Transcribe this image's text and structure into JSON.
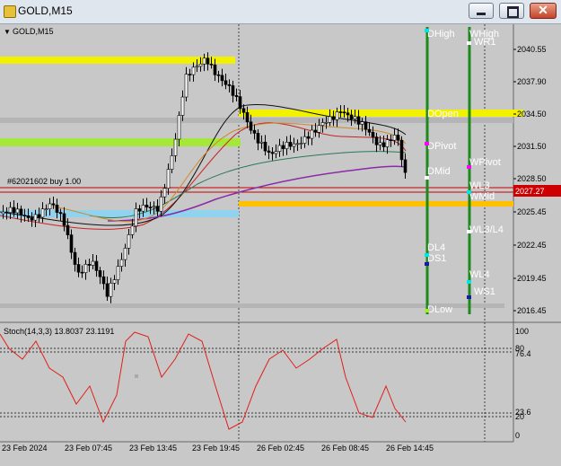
{
  "window": {
    "title": "GOLD,M15",
    "minimize_icon": "minimize-icon",
    "maximize_icon": "maximize-icon",
    "close_icon": "close-icon"
  },
  "chart": {
    "symbol_label": "GOLD,M15",
    "position_label": "#62021602 buy 1.00",
    "current_price": "2027.27",
    "price_ticks": [
      "2040.55",
      "2037.90",
      "2034.50",
      "2031.50",
      "2028.50",
      "2025.45",
      "2022.45",
      "2019.45",
      "2016.45"
    ],
    "time_ticks": [
      "23 Feb 2024",
      "23 Feb 07:45",
      "23 Feb 13:45",
      "23 Feb 19:45",
      "26 Feb 02:45",
      "26 Feb 08:45",
      "26 Feb 14:45"
    ],
    "levels": {
      "dhigh": "DHigh",
      "whigh": "WHigh",
      "wr1": "WR1",
      "dopen": "DOpen",
      "dpivot": "DPivot",
      "dmid": "DMid",
      "wpivot": "WPivot",
      "wl3": "WL3",
      "wmid": "WMid",
      "wl3l4": "WL3/L4",
      "dl4": "DL4",
      "ds1": "DS1",
      "wl4": "WL4",
      "ws1": "WS1",
      "dlow": "DLow"
    },
    "colors": {
      "yellow_band": "#f2f200",
      "green_band": "#a6e83a",
      "blue_band": "#8fd3ee",
      "orange_line": "#ffc000",
      "gray_band": "#b5b5b5",
      "price_line": "#cc0000",
      "oscillator": "#e0201a",
      "vertical_green": "#1d8a1d"
    }
  },
  "stoch": {
    "label": "Stoch(14,3,3) 13.8037 23.1191",
    "ticks": [
      "100",
      "80",
      "76.4",
      "23.6",
      "20",
      "0"
    ]
  }
}
